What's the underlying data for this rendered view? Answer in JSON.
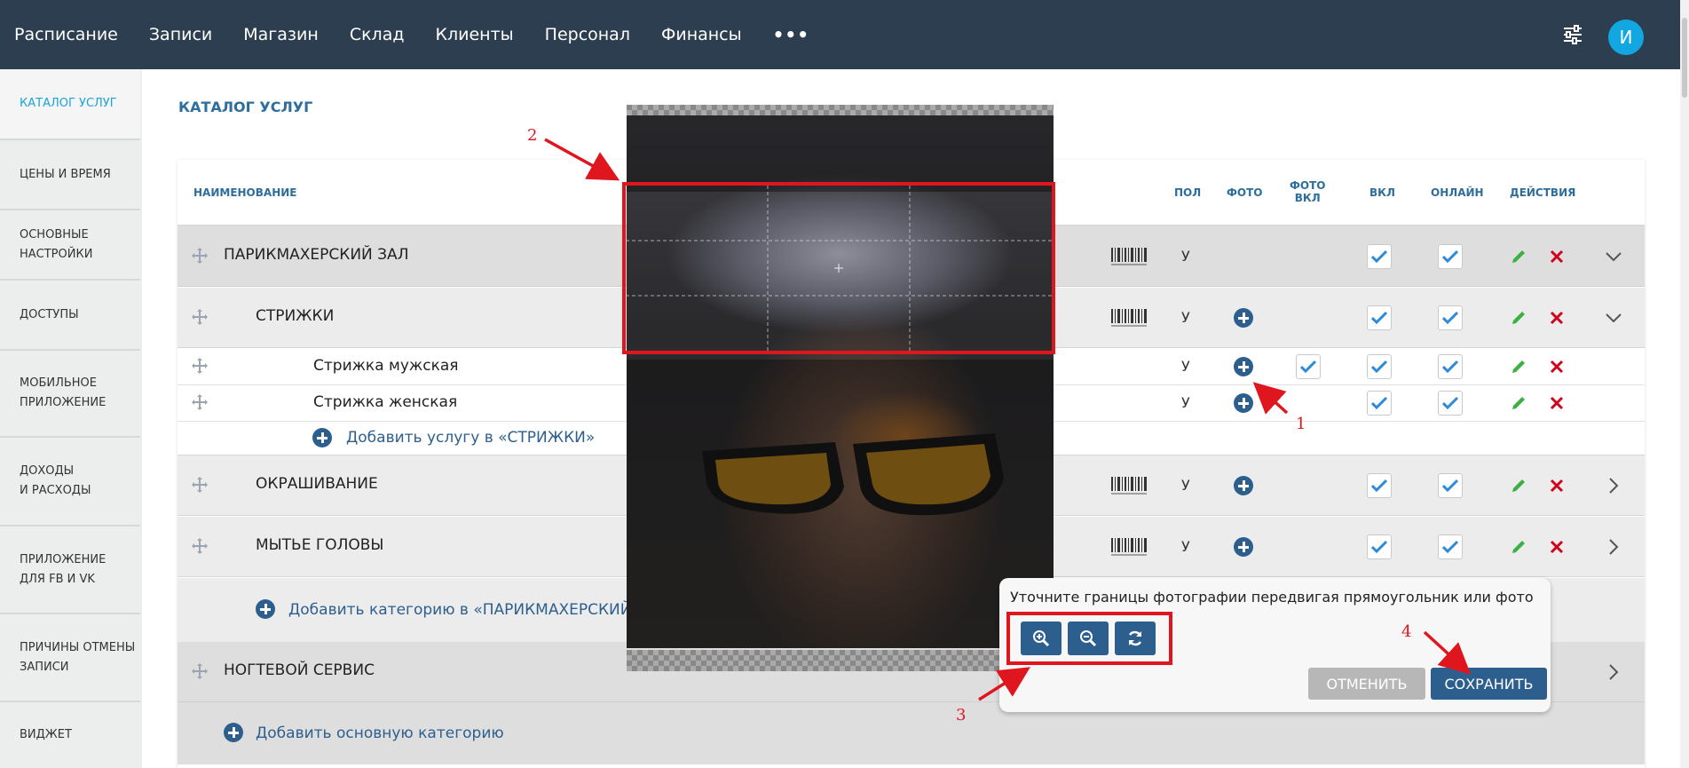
{
  "nav": {
    "items": [
      "Расписание",
      "Записи",
      "Магазин",
      "Склад",
      "Клиенты",
      "Персонал",
      "Финансы"
    ],
    "more": "•••",
    "avatar_letter": "И"
  },
  "sidebar": {
    "items": [
      {
        "label": "КАТАЛОГ УСЛУГ",
        "active": true
      },
      {
        "label": "ЦЕНЫ И ВРЕМЯ"
      },
      {
        "label": "ОСНОВНЫЕ\nНАСТРОЙКИ"
      },
      {
        "label": "ДОСТУПЫ"
      },
      {
        "label": "МОБИЛЬНОЕ\nПРИЛОЖЕНИЕ"
      },
      {
        "label": "ДОХОДЫ\nИ РАСХОДЫ"
      },
      {
        "label": "ПРИЛОЖЕНИЕ\nДЛЯ FB И VK"
      },
      {
        "label": "ПРИЧИНЫ ОТМЕНЫ\nЗАПИСИ"
      },
      {
        "label": "ВИДЖЕТ"
      }
    ]
  },
  "page": {
    "title": "КАТАЛОГ УСЛУГ"
  },
  "table": {
    "headers": {
      "name": "НАИМЕНОВАНИЕ",
      "sex": "ПОЛ",
      "photo": "ФОТО",
      "photo_on": "ФОТО\nВКЛ",
      "on": "ВКЛ",
      "online": "ОНЛАЙН",
      "actions": "ДЕЙСТВИЯ"
    },
    "rows": {
      "hair_hall": {
        "label": "ПАРИКМАХЕРСКИЙ ЗАЛ",
        "sex": "У"
      },
      "haircuts": {
        "label": "СТРИЖКИ",
        "sex": "У"
      },
      "men_cut": {
        "label": "Стрижка мужская",
        "sex": "У"
      },
      "women_cut": {
        "label": "Стрижка женская",
        "sex": "У"
      },
      "add_service": {
        "label": "Добавить услугу в «СТРИЖКИ»"
      },
      "coloring": {
        "label": "ОКРАШИВАНИЕ",
        "sex": "У"
      },
      "washing": {
        "label": "МЫТЬЕ ГОЛОВЫ",
        "sex": "У"
      },
      "add_category": {
        "label": "Добавить категорию в «ПАРИКМАХЕРСКИЙ ЗАЛ»"
      },
      "nail": {
        "label": "НОГТЕВОЙ СЕРВИС"
      },
      "add_main": {
        "label": "Добавить основную категорию"
      }
    }
  },
  "dialog": {
    "hint": "Уточните границы фотографии передвигая прямоугольник или фото",
    "cancel": "ОТМЕНИТЬ",
    "save": "СОХРАНИТЬ",
    "tools": [
      "zoom-in-icon",
      "zoom-out-icon",
      "refresh-icon"
    ]
  },
  "annotations": [
    "1",
    "2",
    "3",
    "4"
  ],
  "colors": {
    "topbar": "#2d3e50",
    "accent": "#2d5f8e",
    "annotation": "#e0161e",
    "edit": "#3cb043",
    "delete": "#d0021b"
  }
}
